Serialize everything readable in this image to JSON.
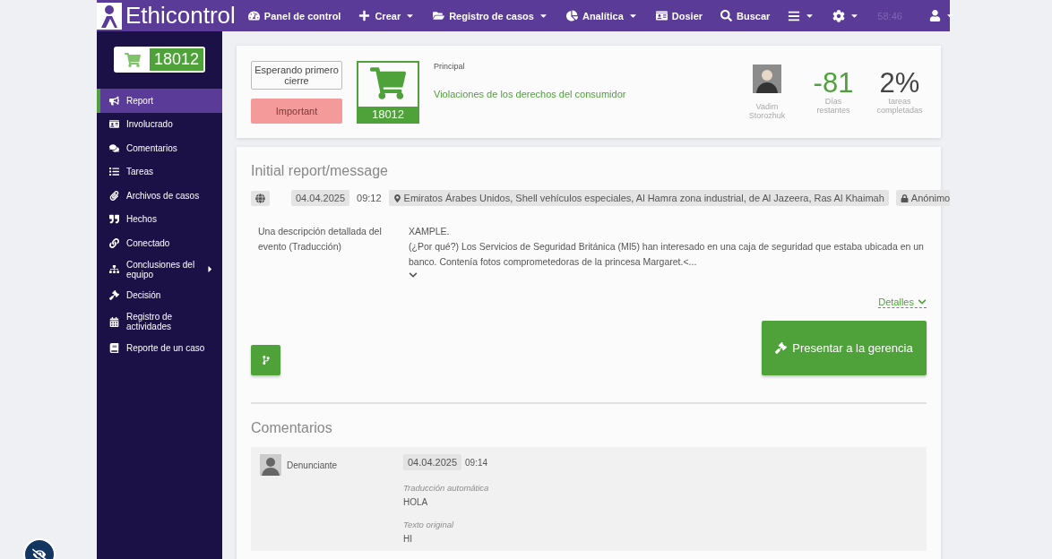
{
  "navbar": {
    "brand": "Ethicontrol",
    "items": [
      {
        "label": "Panel de control",
        "caret": false
      },
      {
        "label": "Crear",
        "caret": true
      },
      {
        "label": "Registro de casos",
        "caret": true
      },
      {
        "label": "Analítica",
        "caret": true
      },
      {
        "label": "Dosier",
        "caret": false
      },
      {
        "label": "Buscar",
        "caret": false
      }
    ],
    "time": "58:46"
  },
  "sidebar": {
    "case_number": "18012",
    "items": [
      {
        "label": "Report",
        "selected": true,
        "expandable": false
      },
      {
        "label": "Involucrado",
        "selected": false,
        "expandable": false
      },
      {
        "label": "Comentarios",
        "selected": false,
        "expandable": false
      },
      {
        "label": "Tareas",
        "selected": false,
        "expandable": false
      },
      {
        "label": "Archivos de casos",
        "selected": false,
        "expandable": false
      },
      {
        "label": "Hechos",
        "selected": false,
        "expandable": false
      },
      {
        "label": "Conectado",
        "selected": false,
        "expandable": false
      },
      {
        "label": "Conclusiones del equipo",
        "selected": false,
        "expandable": true
      },
      {
        "label": "Decisión",
        "selected": false,
        "expandable": false
      },
      {
        "label": "Registro de actividades",
        "selected": false,
        "expandable": false
      },
      {
        "label": "Reporte de un caso",
        "selected": false,
        "expandable": false
      }
    ]
  },
  "header": {
    "status": "Esperando primero cierre",
    "priority": "Important",
    "case_number": "18012",
    "category_label": "Principal",
    "category": "Violaciones de los derechos del consumidor",
    "assignee": "Vadim Storozhuk",
    "days": "-81",
    "days_label": "Días restantes",
    "progress": "2%",
    "progress_label": "tareas completadas"
  },
  "report": {
    "title": "Initial report/message",
    "date": "04.04.2025",
    "time": "09:12",
    "location": "Emiratos Árabes Unidos, Shell vehículos especiales, Al Hamra zona industrial, de Al Jazeera, Ras Al Khaimah",
    "anonymity": "Anónimo",
    "field_label": "Una descripción detallada del evento (Traducción)",
    "lines": [
      "XAMPLE.",
      "(¿Por qué?) Los Servicios de Seguridad Británica (MI5) han interesado en una caja de seguridad que estaba ubicada en un banco. Contenía fotos comprometedoras de la princesa Margaret.<..."
    ],
    "details_link": "Detalles",
    "submit_button": "Presentar a la gerencia"
  },
  "comments": {
    "title": "Comentarios",
    "items": [
      {
        "author": "Denunciante",
        "date": "04.04.2025",
        "time": "09:14",
        "translation_label": "Traducción automática",
        "translation": "HOLA",
        "original_label": "Texto original",
        "original": "HI"
      }
    ]
  }
}
